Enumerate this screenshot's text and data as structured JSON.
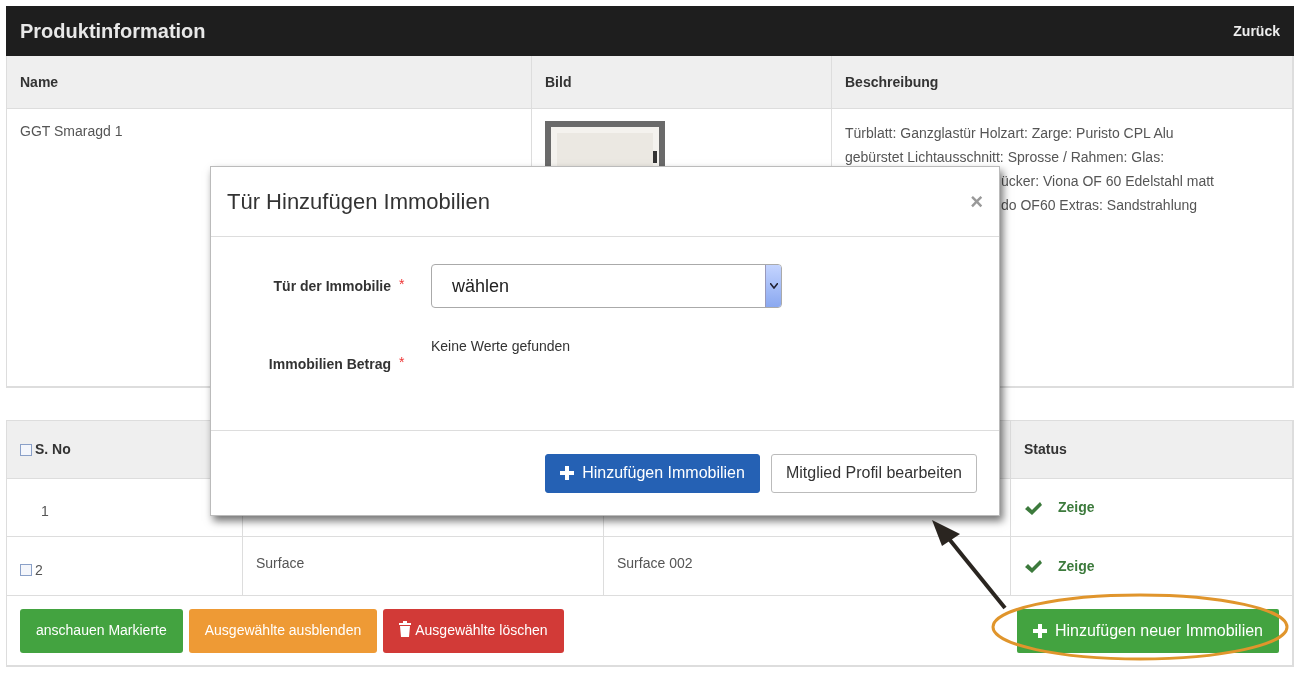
{
  "header": {
    "title": "Produktinformation",
    "back_link": "Zurück"
  },
  "product_table": {
    "columns": [
      "Name",
      "Bild",
      "Beschreibung"
    ],
    "row": {
      "name": "GGT Smaragd 1",
      "description_lines": [
        {
          "text": "Türblatt: Ganzglastür Holzart: Zarge: Puristo CPL Alu",
          "partial": false
        },
        {
          "text": "gebürstet Lichtausschnitt: Sprosse / Rahmen: Glas:",
          "partial": false
        },
        {
          "text": "ücker: Viona OF 60 Edelstahl matt",
          "partial": true
        },
        {
          "text": "do OF60 Extras: Sandstrahlung",
          "partial": true
        }
      ]
    }
  },
  "list_table": {
    "columns": [
      {
        "label": "S. No",
        "checked": false
      },
      {},
      {},
      {
        "label": "Status"
      }
    ],
    "rows": [
      {
        "cells": [
          "1",
          "",
          ""
        ],
        "status": "Zeige"
      },
      {
        "checked": false,
        "cells": [
          "2",
          "Surface",
          "Surface 002"
        ],
        "status": "Zeige"
      }
    ],
    "buttons": [
      {
        "label": "anschauen Markierte",
        "kind": "success"
      },
      {
        "label": "Ausgewählte ausblenden",
        "kind": "warning"
      },
      {
        "label": "Ausgewählte löschen",
        "kind": "danger"
      }
    ],
    "add_button": {
      "label": "Hinzufügen neuer Immobilien",
      "highlighted": true
    }
  },
  "modal": {
    "title": "Tür Hinzufügen Immobilien",
    "close": "×",
    "fields": [
      {
        "label": "Tür der Immobilie",
        "required_mark": "*",
        "kind": "select",
        "value": "wählen"
      },
      {
        "label": "Immobilien Betrag",
        "required_mark": "*",
        "kind": "text",
        "value": "Keine Werte gefunden"
      }
    ],
    "buttons": [
      {
        "label": "Hinzufügen Immobilien",
        "kind": "primary"
      },
      {
        "label": "Mitglied Profil bearbeiten",
        "kind": "default"
      }
    ]
  }
}
